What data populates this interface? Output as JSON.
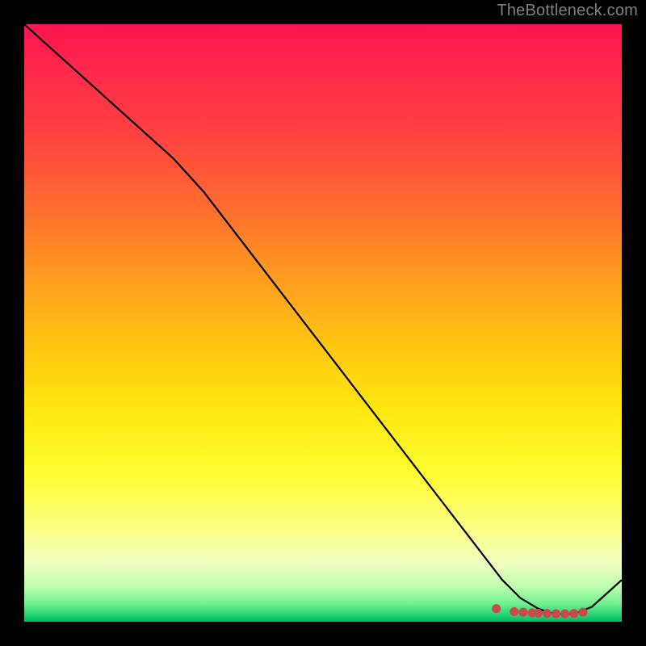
{
  "watermark": "TheBottleneck.com",
  "chart_data": {
    "type": "line",
    "title": "",
    "xlabel": "",
    "ylabel": "",
    "xlim": [
      0,
      100
    ],
    "ylim": [
      0,
      100
    ],
    "series": [
      {
        "name": "curve",
        "x": [
          0,
          5,
          10,
          15,
          20,
          25,
          30,
          35,
          40,
          45,
          50,
          55,
          60,
          65,
          70,
          75,
          80,
          83,
          86,
          88,
          90,
          92,
          95,
          100
        ],
        "y": [
          100,
          95.5,
          91,
          86.5,
          82,
          77.5,
          72,
          65.5,
          59,
          52.5,
          46,
          39.5,
          33,
          26.5,
          20,
          13.5,
          7,
          4,
          2.2,
          1.5,
          1.3,
          1.3,
          2.5,
          7
        ]
      },
      {
        "name": "markers",
        "type": "scatter",
        "x": [
          79,
          82,
          83.5,
          85,
          86,
          87.5,
          89,
          90.5,
          92,
          93.5
        ],
        "y": [
          2.2,
          1.7,
          1.6,
          1.5,
          1.45,
          1.4,
          1.35,
          1.35,
          1.4,
          1.6
        ]
      }
    ],
    "colors": {
      "curve": "#000000",
      "marker_fill": "#c84a4a",
      "marker_stroke": "#c84a4a"
    }
  }
}
